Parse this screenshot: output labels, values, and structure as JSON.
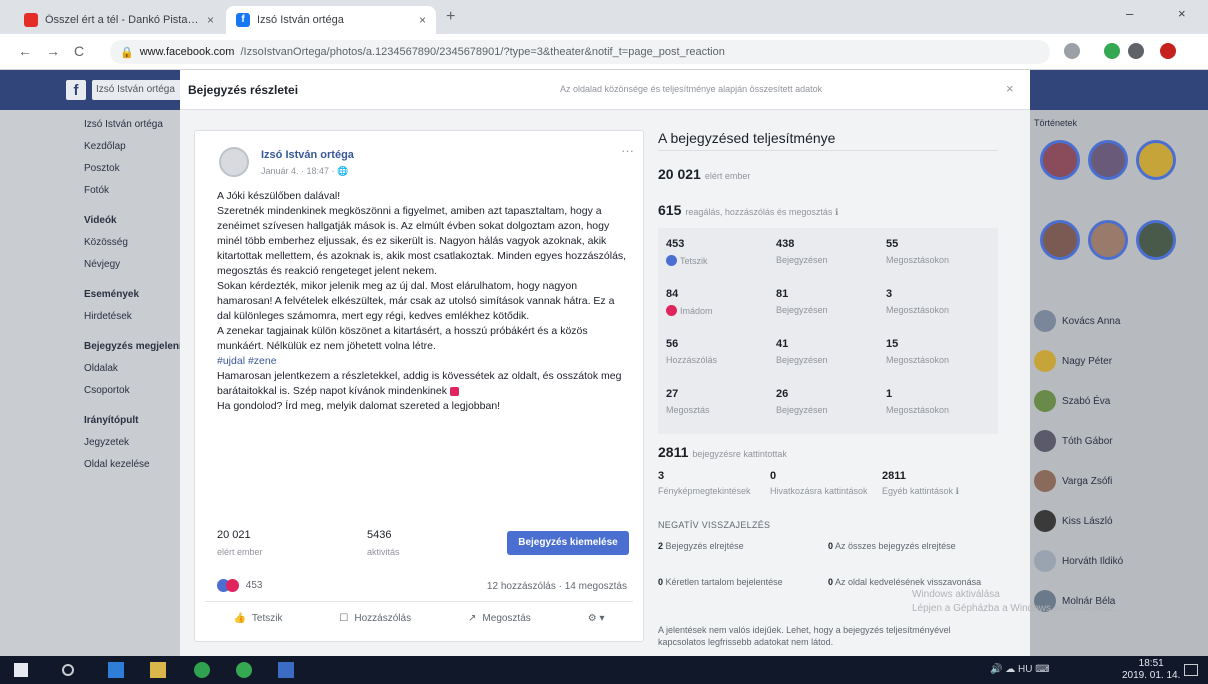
{
  "browser": {
    "tabs": [
      {
        "title": "Ősszel ért a tél - Dankó Pista – YouTube",
        "active": false
      },
      {
        "title": "Izsó István ortéga",
        "active": true
      }
    ],
    "url_host": "www.facebook.com",
    "url_rest": "/IzsoIstvanOrtega/photos/a.1234567890/2345678901/?type=3&theater&notif_t=page_post_reaction",
    "tab_close": "×",
    "new_tab": "+",
    "window_controls": {
      "minimize": "–",
      "close": "×"
    },
    "nav": {
      "back": "←",
      "forward": "→",
      "reload": "C",
      "lock": "🔒"
    }
  },
  "facebook": {
    "logo": "f",
    "search": "Izsó István ortéga",
    "left_nav": [
      {
        "label": "Izsó István ortéga",
        "head": false
      },
      {
        "label": "Kezdőlap",
        "head": false
      },
      {
        "label": "Posztok",
        "head": false
      },
      {
        "label": "Fotók",
        "head": false
      },
      {
        "label": "Videók",
        "head": true
      },
      {
        "label": "Közösség",
        "head": false
      },
      {
        "label": "Névjegy",
        "head": false
      },
      {
        "label": "Események",
        "head": true
      },
      {
        "label": "Hirdetések",
        "head": false
      },
      {
        "label": "Bejegyzés megjelenítése",
        "head": true
      },
      {
        "label": "Oldalak",
        "head": false
      },
      {
        "label": "Csoportok",
        "head": false
      },
      {
        "label": "Irányítópult",
        "head": true
      },
      {
        "label": "Jegyzetek",
        "head": false
      },
      {
        "label": "Oldal kezelése",
        "head": false
      }
    ],
    "stories_label": "Történetek",
    "contacts": [
      {
        "name": "Kovács Anna"
      },
      {
        "name": "Nagy Péter"
      },
      {
        "name": "Szabó Éva"
      },
      {
        "name": "Tóth Gábor"
      },
      {
        "name": "Varga Zsófi"
      },
      {
        "name": "Kiss László"
      },
      {
        "name": "Horváth Ildikó"
      },
      {
        "name": "Molnár Béla"
      }
    ]
  },
  "modal": {
    "title": "Bejegyzés részletei",
    "hint": "Az oldalad közönsége és teljesítménye alapján összesített adatok",
    "close": "×"
  },
  "post": {
    "author": "Izsó István ortéga",
    "meta": "Január 4. · 18:47 · 🌐",
    "more": "···",
    "paragraphs": [
      "A Jóki készülőben dalával!",
      "Szeretnék mindenkinek megköszönni a figyelmet, amiben azt tapasztaltam, hogy a zenéimet szívesen hallgatják mások is. Az elmúlt évben sokat dolgoztam azon, hogy minél több emberhez eljussak, és ez sikerült is. Nagyon hálás vagyok azoknak, akik kitartottak mellettem, és azoknak is, akik most csatlakoztak. Minden egyes hozzászólás, megosztás és reakció rengeteget jelent nekem.",
      "Sokan kérdezték, mikor jelenik meg az új dal. Most elárulhatom, hogy nagyon hamarosan! A felvételek elkészültek, már csak az utolsó simítások vannak hátra. Ez a dal különleges számomra, mert egy régi, kedves emlékhez kötődik.",
      "A zenekar tagjainak külön köszönet a kitartásért, a hosszú próbákért és a közös munkáért. Nélkülük ez nem jöhetett volna létre.",
      "Hamarosan jelentkezem a részletekkel, addig is kövessétek az oldalt, és osszátok meg barátaitokkal is. Szép napot kívánok mindenkinek ",
      "Ha gondolod? Írd meg, melyik dalomat szereted a legjobban!"
    ],
    "link": "#ujdal #zene",
    "stats": {
      "reach_value": "20 021",
      "reach_label": "elért ember",
      "eng_value": "5436",
      "eng_label": "aktivitás"
    },
    "boost_button": "Bejegyzés kiemelése",
    "reactions_count": "453",
    "comments_shares": "12 hozzászólás · 14 megosztás",
    "actions": {
      "like": "Tetszik",
      "comment": "Hozzászólás",
      "share": "Megosztás",
      "options": "⚙ ▾"
    }
  },
  "performance": {
    "title": "A bejegyzésed teljesítménye",
    "reach_value": "20 021",
    "reach_label": "elért ember",
    "eng_value": "615",
    "eng_label": "reagálás, hozzászólás és megosztás ℹ",
    "grid": [
      {
        "value": "453",
        "label": "Tetszik",
        "icon": "like"
      },
      {
        "value": "438",
        "label": "Bejegyzésen",
        "icon": ""
      },
      {
        "value": "55",
        "label": "Megosztásokon",
        "icon": ""
      },
      {
        "value": "84",
        "label": "Imádom",
        "icon": "love"
      },
      {
        "value": "81",
        "label": "Bejegyzésen",
        "icon": ""
      },
      {
        "value": "3",
        "label": "Megosztásokon",
        "icon": ""
      },
      {
        "value": "56",
        "label": "Hozzászólás",
        "icon": ""
      },
      {
        "value": "41",
        "label": "Bejegyzésen",
        "icon": ""
      },
      {
        "value": "15",
        "label": "Megosztásokon",
        "icon": ""
      },
      {
        "value": "27",
        "label": "Megosztás",
        "icon": ""
      },
      {
        "value": "26",
        "label": "Bejegyzésen",
        "icon": ""
      },
      {
        "value": "1",
        "label": "Megosztásokon",
        "icon": ""
      }
    ],
    "clicks_value": "2811",
    "clicks_label": "bejegyzésre kattintottak",
    "click_breakdown": [
      {
        "value": "3",
        "label": "Fényképmegtekintések"
      },
      {
        "value": "0",
        "label": "Hivatkozásra kattintások"
      },
      {
        "value": "2811",
        "label": "Egyéb kattintások ℹ"
      }
    ],
    "negative_head": "NEGATÍV VISSZAJELZÉS",
    "negative": [
      {
        "value": "2",
        "label": "Bejegyzés elrejtése"
      },
      {
        "value": "0",
        "label": "Az összes bejegyzés elrejtése"
      },
      {
        "value": "0",
        "label": "Kéretlen tartalom bejelentése"
      },
      {
        "value": "0",
        "label": "Az oldal kedvelésének visszavonása"
      }
    ],
    "footnote": "A jelentések nem valós idejűek. Lehet, hogy a bejegyzés teljesítményével kapcsolatos legfrissebb adatokat nem látod."
  },
  "watermark": [
    "Windows aktiválása",
    "Lépjen a Gépházba a Windows aktiválásához."
  ],
  "taskbar": {
    "tray": "🔊 ☁ HU  ⌨",
    "time": "18:51",
    "date": "2019. 01. 14."
  },
  "colors": {
    "facebook_blue": "#4a6fd0",
    "bluebar": "#32457a",
    "link": "#385898",
    "love": "#e0245e"
  }
}
